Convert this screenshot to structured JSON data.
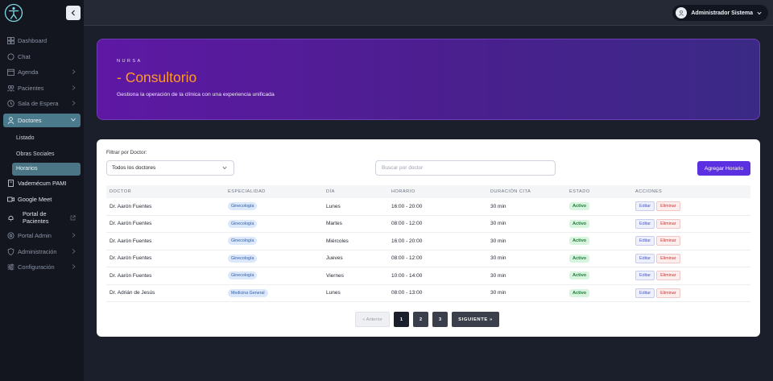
{
  "sidebar": {
    "items": [
      {
        "label": "Dashboard",
        "icon": "dashboard-icon"
      },
      {
        "label": "Chat",
        "icon": "chat-icon"
      },
      {
        "label": "Agenda",
        "icon": "calendar-icon"
      },
      {
        "label": "Pacientes",
        "icon": "patients-icon"
      },
      {
        "label": "Sala de Espera",
        "icon": "clock-icon"
      },
      {
        "label": "Doctores",
        "icon": "doctor-icon"
      },
      {
        "label": "Vademécum PAMI",
        "icon": "book-icon"
      },
      {
        "label": "Google Meet",
        "icon": "video-icon"
      },
      {
        "label": "Portal de Pacientes",
        "icon": "bell-icon"
      },
      {
        "label": "Portal Admin",
        "icon": "admin-icon"
      },
      {
        "label": "Administración",
        "icon": "shield-icon"
      },
      {
        "label": "Configuración",
        "icon": "sliders-icon"
      }
    ],
    "doctor_sub": [
      "Listado",
      "Obras Sociales",
      "Horarios"
    ]
  },
  "header": {
    "user_name": "Administrador Sistema"
  },
  "banner": {
    "eyebrow": "NURSA",
    "title": "- Consultorio",
    "subtitle": "Gestiona la operación de la clínica con una experiencia unificada"
  },
  "filters": {
    "label": "Filtrar por Doctor:",
    "selected": "Todos los doctores",
    "search_placeholder": "Buscar por doctor",
    "add_label": "Agregar Horario"
  },
  "table": {
    "headers": [
      "DOCTOR",
      "ESPECIALIDAD",
      "DÍA",
      "HORARIO",
      "DURACIÓN CITA",
      "ESTADO",
      "ACCIONES"
    ],
    "rows": [
      {
        "doctor": "Dr. Aarón Fuentes",
        "especialidad": "Ginecología",
        "dia": "Lunes",
        "horario": "16:00 - 20:00",
        "duracion": "30 min",
        "estado": "Activo"
      },
      {
        "doctor": "Dr. Aarón Fuentes",
        "especialidad": "Ginecología",
        "dia": "Martes",
        "horario": "08:00 - 12:00",
        "duracion": "30 min",
        "estado": "Activo"
      },
      {
        "doctor": "Dr. Aarón Fuentes",
        "especialidad": "Ginecología",
        "dia": "Miércoles",
        "horario": "16:00 - 20:00",
        "duracion": "30 min",
        "estado": "Activo"
      },
      {
        "doctor": "Dr. Aarón Fuentes",
        "especialidad": "Ginecología",
        "dia": "Jueves",
        "horario": "08:00 - 12:00",
        "duracion": "30 min",
        "estado": "Activo"
      },
      {
        "doctor": "Dr. Aarón Fuentes",
        "especialidad": "Ginecología",
        "dia": "Viernes",
        "horario": "10:00 - 14:00",
        "duracion": "30 min",
        "estado": "Activo"
      },
      {
        "doctor": "Dr. Adrián de Jesús",
        "especialidad": "Medicina General",
        "dia": "Lunes",
        "horario": "08:00 - 13:00",
        "duracion": "30 min",
        "estado": "Activo"
      }
    ],
    "edit_label": "Editar",
    "delete_label": "Eliminar"
  },
  "pagination": {
    "prev": "« Anterior",
    "pages": [
      "1",
      "2",
      "3"
    ],
    "current": "1",
    "next": "SIGUIENTE »"
  },
  "colors": {
    "accent": "#5a30e0",
    "banner_title": "#ff9a2a",
    "sidebar_active": "#4a7a8c"
  }
}
